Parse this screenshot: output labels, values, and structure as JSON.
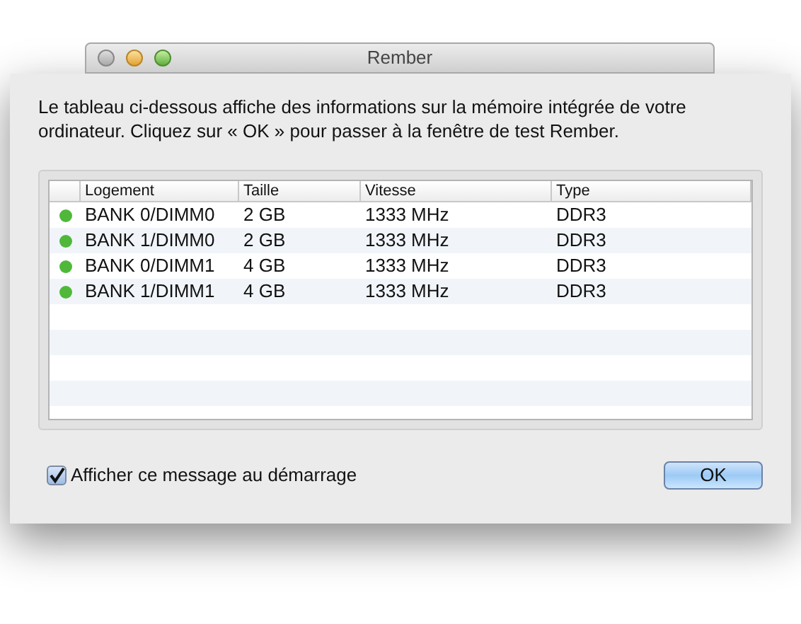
{
  "window": {
    "title": "Rember"
  },
  "message": "Le tableau ci-dessous affiche des informations sur la mémoire intégrée de votre ordinateur. Cliquez sur « OK » pour passer à la fenêtre de test Rember.",
  "table": {
    "columns": [
      "Logement",
      "Taille",
      "Vitesse",
      "Type"
    ],
    "rows": [
      {
        "color": "#4fb83a",
        "cells": [
          "BANK 0/DIMM0",
          "2 GB",
          "1333 MHz",
          "DDR3"
        ]
      },
      {
        "color": "#4fb83a",
        "cells": [
          "BANK 1/DIMM0",
          "2 GB",
          "1333 MHz",
          "DDR3"
        ]
      },
      {
        "color": "#4fb83a",
        "cells": [
          "BANK 0/DIMM1",
          "4 GB",
          "1333 MHz",
          "DDR3"
        ]
      },
      {
        "color": "#4fb83a",
        "cells": [
          "BANK 1/DIMM1",
          "4 GB",
          "1333 MHz",
          "DDR3"
        ]
      }
    ]
  },
  "checkbox": {
    "label": "Afficher ce message au démarrage",
    "checked": true
  },
  "buttons": [
    "OK"
  ]
}
